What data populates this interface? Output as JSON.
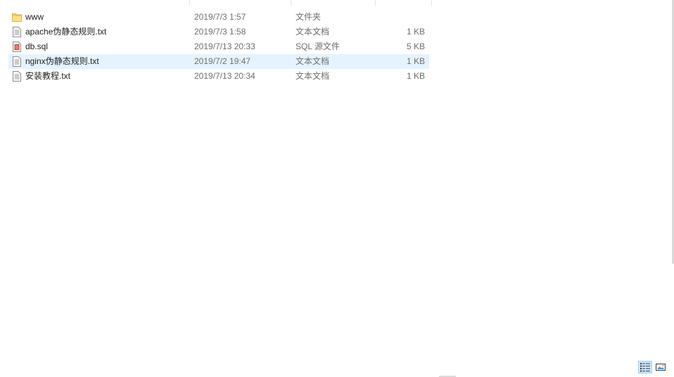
{
  "colors": {
    "selected_row_bg": "#e5f3ff",
    "folder_yellow": "#ffd566",
    "sql_icon_red": "#c0392b"
  },
  "files": [
    {
      "name": "www",
      "date": "2019/7/3 1:57",
      "type": "文件夹",
      "size": "",
      "icon": "folder-icon",
      "selected": false
    },
    {
      "name": "apache伪静态规则.txt",
      "date": "2019/7/3 1:58",
      "type": "文本文档",
      "size": "1 KB",
      "icon": "text-file-icon",
      "selected": false
    },
    {
      "name": "db.sql",
      "date": "2019/7/13 20:33",
      "type": "SQL 源文件",
      "size": "5 KB",
      "icon": "sql-file-icon",
      "selected": false
    },
    {
      "name": "nginx伪静态规则.txt",
      "date": "2019/7/2 19:47",
      "type": "文本文档",
      "size": "1 KB",
      "icon": "text-file-icon",
      "selected": true
    },
    {
      "name": "安装教程.txt",
      "date": "2019/7/13 20:34",
      "type": "文本文档",
      "size": "1 KB",
      "icon": "text-file-icon",
      "selected": false
    }
  ],
  "view_buttons": [
    {
      "icon": "details-view-icon",
      "active": true
    },
    {
      "icon": "large-icons-view-icon",
      "active": false
    }
  ]
}
